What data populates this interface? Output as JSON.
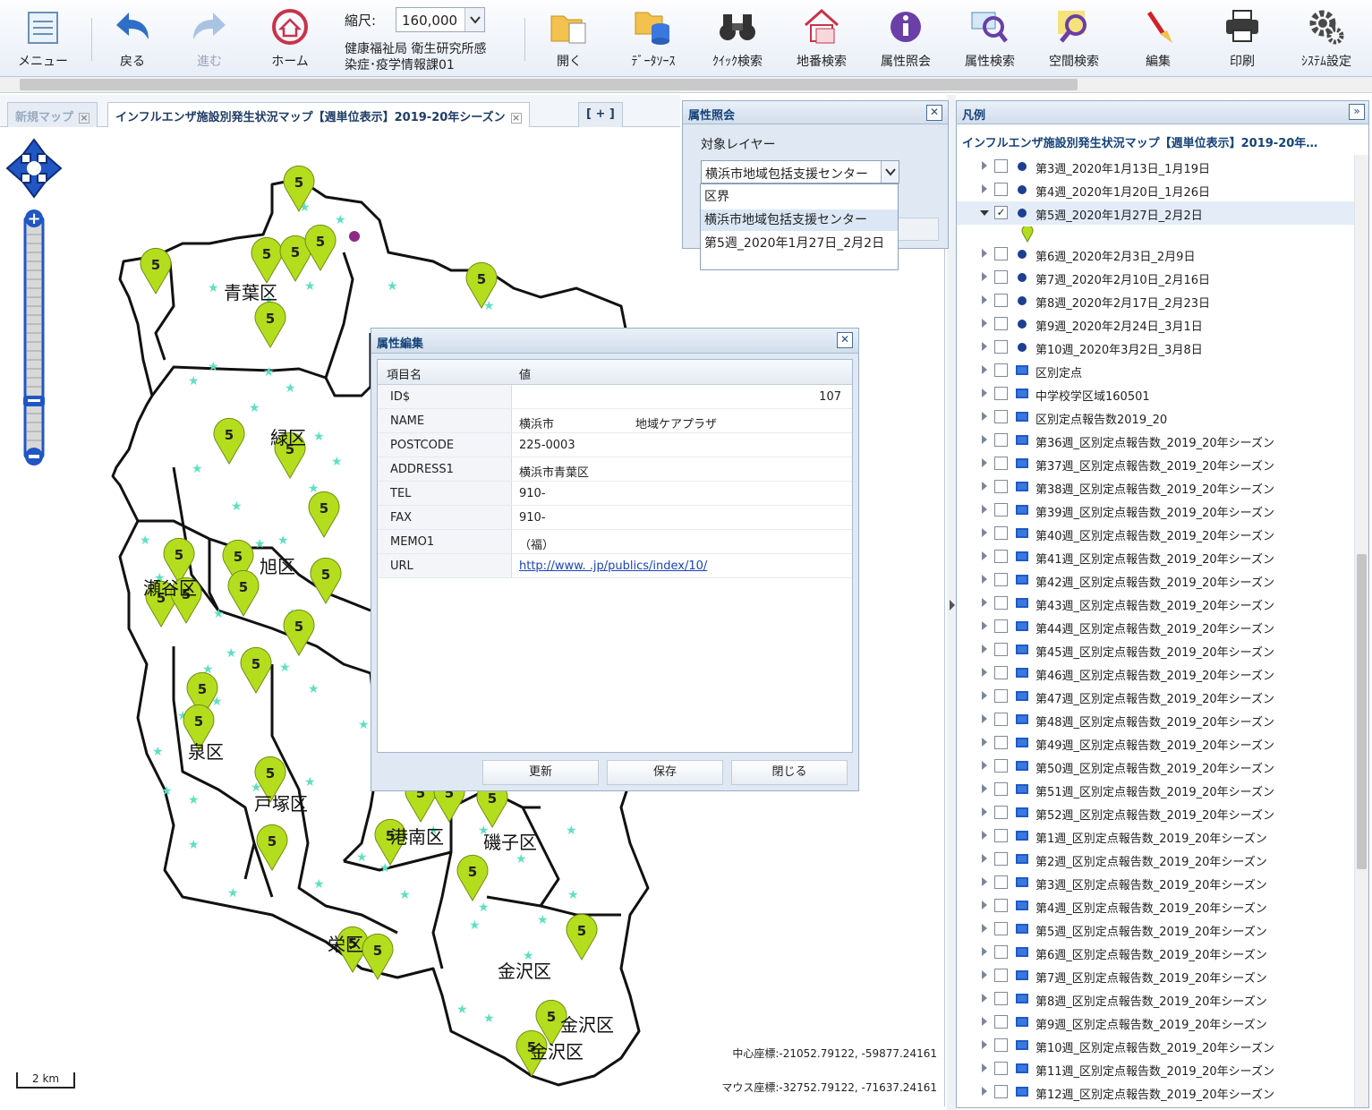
{
  "toolbar": {
    "menu": "メニュー",
    "back": "戻る",
    "forward": "進む",
    "home": "ホーム",
    "scale_label": "縮尺:",
    "scale_value": "160,000",
    "org_line1": "健康福祉局 衛生研究所感",
    "org_line2": "染症･疫学情報課01",
    "open": "開く",
    "datasource": "ﾃﾞｰﾀｿｰｽ",
    "quick_search": "ｸｲｯｸ検索",
    "lot_search": "地番検索",
    "attr_query": "属性照会",
    "attr_search": "属性検索",
    "spatial_search": "空間検索",
    "edit": "編集",
    "print": "印刷",
    "system_settings": "ｼｽﾃﾑ設定"
  },
  "tabs": {
    "new_map": "新規マップ",
    "active": "インフルエンザ施設別発生状況マップ【週単位表示】2019-20年シーズン",
    "add": "[ + ]"
  },
  "map": {
    "wards": [
      "青葉区",
      "緑区",
      "旭区",
      "瀬谷区",
      "泉区",
      "戸塚区",
      "港南区",
      "磯子区",
      "栄区",
      "金沢区",
      "金沢区",
      "金沢区"
    ],
    "marker_label": "5",
    "center_coord": "中心座標:-21052.79122, -59877.24161",
    "mouse_coord": "マウス座標:-32752.79122, -71637.24161",
    "scalebar": "2 km"
  },
  "prop_query": {
    "title": "属性照会",
    "layer_label": "対象レイヤー",
    "selected": "横浜市地域包括支援センター",
    "options": [
      "区界",
      "横浜市地域包括支援センター",
      "第5週_2020年1月27日_2月2日"
    ]
  },
  "prop_edit": {
    "title": "属性編集",
    "col_name": "項目名",
    "col_value": "値",
    "rows": [
      {
        "key": "ID$",
        "value": "107"
      },
      {
        "key": "NAME",
        "value": "横浜市　　　　　　　地域ケアプラザ"
      },
      {
        "key": "POSTCODE",
        "value": "225-0003"
      },
      {
        "key": "ADDRESS1",
        "value": "横浜市青葉区"
      },
      {
        "key": "TEL",
        "value": "910-"
      },
      {
        "key": "FAX",
        "value": "910-"
      },
      {
        "key": "MEMO1",
        "value": "（福）"
      },
      {
        "key": "URL",
        "value": "http://www.                                  .jp/publics/index/10/"
      }
    ],
    "update": "更新",
    "save": "保存",
    "close": "閉じる"
  },
  "legend": {
    "title": "凡例",
    "map_title": "インフルエンザ施設別発生状況マップ【週単位表示】2019-20年…",
    "items": [
      {
        "label": "第3週_2020年1月13日_1月19日",
        "sym": "dot",
        "checked": false
      },
      {
        "label": "第4週_2020年1月20日_1月26日",
        "sym": "dot",
        "checked": false
      },
      {
        "label": "第5週_2020年1月27日_2月2日",
        "sym": "dot",
        "checked": true
      },
      {
        "label": "第6週_2020年2月3日_2月9日",
        "sym": "dot",
        "checked": false
      },
      {
        "label": "第7週_2020年2月10日_2月16日",
        "sym": "dot",
        "checked": false
      },
      {
        "label": "第8週_2020年2月17日_2月23日",
        "sym": "dot",
        "checked": false
      },
      {
        "label": "第9週_2020年2月24日_3月1日",
        "sym": "dot",
        "checked": false
      },
      {
        "label": "第10週_2020年3月2日_3月8日",
        "sym": "dot",
        "checked": false
      },
      {
        "label": "区別定点",
        "sym": "rect",
        "checked": false
      },
      {
        "label": "中学校学区域160501",
        "sym": "rect",
        "checked": false
      },
      {
        "label": "区別定点報告数2019_20",
        "sym": "rect",
        "checked": false
      },
      {
        "label": "第36週_区別定点報告数_2019_20年シーズン",
        "sym": "rect",
        "checked": false
      },
      {
        "label": "第37週_区別定点報告数_2019_20年シーズン",
        "sym": "rect",
        "checked": false
      },
      {
        "label": "第38週_区別定点報告数_2019_20年シーズン",
        "sym": "rect",
        "checked": false
      },
      {
        "label": "第39週_区別定点報告数_2019_20年シーズン",
        "sym": "rect",
        "checked": false
      },
      {
        "label": "第40週_区別定点報告数_2019_20年シーズン",
        "sym": "rect",
        "checked": false
      },
      {
        "label": "第41週_区別定点報告数_2019_20年シーズン",
        "sym": "rect",
        "checked": false
      },
      {
        "label": "第42週_区別定点報告数_2019_20年シーズン",
        "sym": "rect",
        "checked": false
      },
      {
        "label": "第43週_区別定点報告数_2019_20年シーズン",
        "sym": "rect",
        "checked": false
      },
      {
        "label": "第44週_区別定点報告数_2019_20年シーズン",
        "sym": "rect",
        "checked": false
      },
      {
        "label": "第45週_区別定点報告数_2019_20年シーズン",
        "sym": "rect",
        "checked": false
      },
      {
        "label": "第46週_区別定点報告数_2019_20年シーズン",
        "sym": "rect",
        "checked": false
      },
      {
        "label": "第47週_区別定点報告数_2019_20年シーズン",
        "sym": "rect",
        "checked": false
      },
      {
        "label": "第48週_区別定点報告数_2019_20年シーズン",
        "sym": "rect",
        "checked": false
      },
      {
        "label": "第49週_区別定点報告数_2019_20年シーズン",
        "sym": "rect",
        "checked": false
      },
      {
        "label": "第50週_区別定点報告数_2019_20年シーズン",
        "sym": "rect",
        "checked": false
      },
      {
        "label": "第51週_区別定点報告数_2019_20年シーズン",
        "sym": "rect",
        "checked": false
      },
      {
        "label": "第52週_区別定点報告数_2019_20年シーズン",
        "sym": "rect",
        "checked": false
      },
      {
        "label": "第1週_区別定点報告数_2019_20年シーズン",
        "sym": "rect",
        "checked": false
      },
      {
        "label": "第2週_区別定点報告数_2019_20年シーズン",
        "sym": "rect",
        "checked": false
      },
      {
        "label": "第3週_区別定点報告数_2019_20年シーズン",
        "sym": "rect",
        "checked": false
      },
      {
        "label": "第4週_区別定点報告数_2019_20年シーズン",
        "sym": "rect",
        "checked": false
      },
      {
        "label": "第5週_区別定点報告数_2019_20年シーズン",
        "sym": "rect",
        "checked": false
      },
      {
        "label": "第6週_区別定点報告数_2019_20年シーズン",
        "sym": "rect",
        "checked": false
      },
      {
        "label": "第7週_区別定点報告数_2019_20年シーズン",
        "sym": "rect",
        "checked": false
      },
      {
        "label": "第8週_区別定点報告数_2019_20年シーズン",
        "sym": "rect",
        "checked": false
      },
      {
        "label": "第9週_区別定点報告数_2019_20年シーズン",
        "sym": "rect",
        "checked": false
      },
      {
        "label": "第10週_区別定点報告数_2019_20年シーズン",
        "sym": "rect",
        "checked": false
      },
      {
        "label": "第11週_区別定点報告数_2019_20年シーズン",
        "sym": "rect",
        "checked": false
      },
      {
        "label": "第12週_区別定点報告数_2019_20年シーズン",
        "sym": "rect",
        "checked": false
      }
    ]
  },
  "colors": {
    "accent": "#15427a",
    "marker_fill": "#b4dd1e",
    "star": "#5fe0c0",
    "boundary": "#111111"
  }
}
